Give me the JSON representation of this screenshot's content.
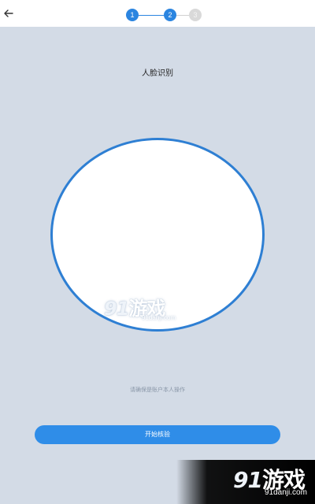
{
  "topbar": {
    "back_icon": "arrow-left-icon",
    "steps": [
      {
        "label": "1",
        "state": "completed"
      },
      {
        "label": "2",
        "state": "current"
      },
      {
        "label": "3",
        "state": "upcoming"
      }
    ],
    "colors": {
      "active": "#2b85e0",
      "inactive": "#d9d9d9"
    }
  },
  "main": {
    "title": "人脸识别",
    "hint": "请确保是账户本人操作",
    "start_button": "开始核验"
  },
  "watermark": {
    "num": "91",
    "brand": "游戏",
    "domain": "91danji.com"
  },
  "colors": {
    "background": "#d3dbe6",
    "primary": "#2f8de8",
    "circle_border": "#2e7fd3"
  }
}
